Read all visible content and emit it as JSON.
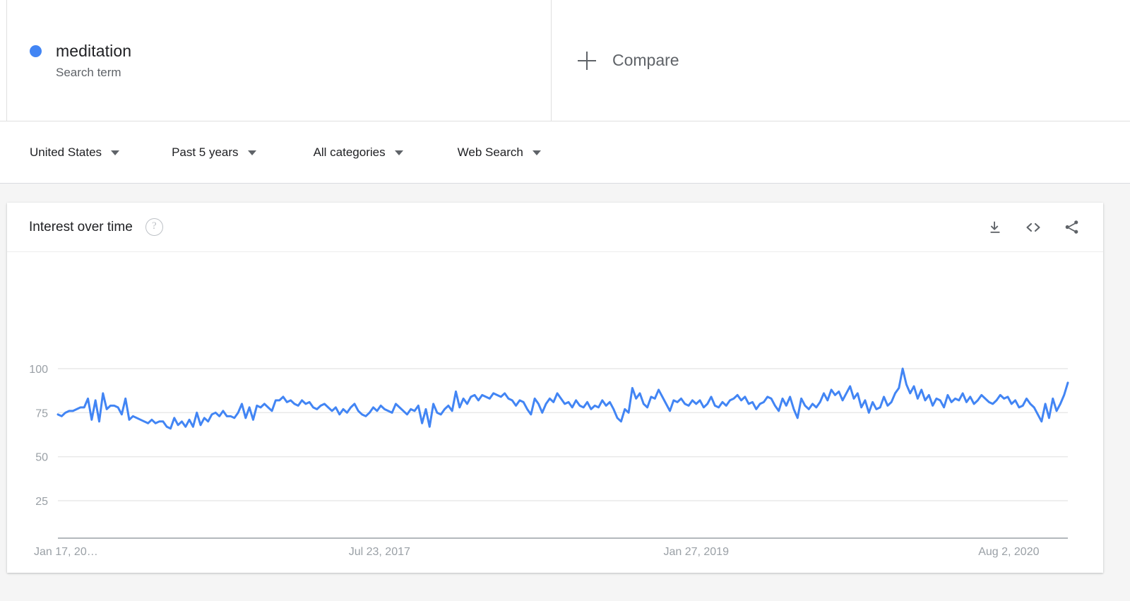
{
  "term": {
    "name": "meditation",
    "subtitle": "Search term",
    "dot_color": "#4285f4"
  },
  "compare": {
    "label": "Compare",
    "icon": "plus-icon"
  },
  "filters": [
    {
      "label": "United States",
      "icon": "chevron-down-icon"
    },
    {
      "label": "Past 5 years",
      "icon": "chevron-down-icon"
    },
    {
      "label": "All categories",
      "icon": "chevron-down-icon"
    },
    {
      "label": "Web Search",
      "icon": "chevron-down-icon"
    }
  ],
  "card": {
    "title": "Interest over time",
    "help_icon": "?",
    "actions": [
      {
        "name": "download-icon",
        "title": "Download CSV"
      },
      {
        "name": "embed-code-icon",
        "title": "Embed"
      },
      {
        "name": "share-icon",
        "title": "Share"
      }
    ]
  },
  "chart_data": {
    "type": "line",
    "title": "Interest over time",
    "xlabel": "",
    "ylabel": "",
    "ylim": [
      0,
      107
    ],
    "yticks": [
      25,
      50,
      75,
      100
    ],
    "grid": true,
    "legend": false,
    "line_color": "#4285f4",
    "line_width": 3,
    "xtick_labels": [
      "Jan 17, 20…",
      "Jul 23, 2017",
      "Jan 27, 2019",
      "Aug 2, 2020"
    ],
    "xtick_positions": [
      0,
      0.3117,
      0.6234,
      0.9351
    ],
    "series": [
      {
        "name": "meditation",
        "values": [
          74,
          73,
          75,
          76,
          76,
          77,
          78,
          78,
          83,
          71,
          82,
          70,
          86,
          77,
          79,
          79,
          78,
          74,
          83,
          71,
          73,
          72,
          71,
          70,
          69,
          71,
          69,
          70,
          70,
          67,
          66,
          72,
          68,
          70,
          67,
          71,
          67,
          75,
          68,
          72,
          70,
          74,
          75,
          73,
          76,
          73,
          73,
          72,
          75,
          80,
          72,
          78,
          71,
          79,
          78,
          80,
          78,
          76,
          82,
          82,
          84,
          81,
          82,
          80,
          79,
          82,
          80,
          81,
          78,
          77,
          79,
          80,
          78,
          76,
          78,
          74,
          77,
          75,
          78,
          80,
          76,
          74,
          73,
          75,
          78,
          76,
          79,
          77,
          76,
          75,
          80,
          78,
          76,
          74,
          77,
          76,
          79,
          69,
          77,
          67,
          80,
          75,
          74,
          77,
          79,
          76,
          87,
          78,
          83,
          80,
          84,
          85,
          82,
          85,
          84,
          83,
          86,
          85,
          84,
          86,
          83,
          82,
          79,
          82,
          81,
          77,
          74,
          83,
          80,
          75,
          80,
          83,
          81,
          86,
          83,
          80,
          81,
          78,
          82,
          79,
          78,
          81,
          77,
          79,
          78,
          82,
          79,
          81,
          77,
          72,
          70,
          77,
          75,
          89,
          83,
          86,
          80,
          78,
          84,
          83,
          88,
          84,
          80,
          76,
          82,
          81,
          83,
          80,
          79,
          82,
          80,
          82,
          78,
          80,
          84,
          79,
          78,
          81,
          79,
          82,
          83,
          85,
          82,
          84,
          80,
          81,
          77,
          80,
          81,
          84,
          83,
          79,
          76,
          83,
          79,
          84,
          77,
          72,
          83,
          79,
          77,
          80,
          78,
          81,
          86,
          82,
          88,
          85,
          87,
          82,
          86,
          90,
          83,
          86,
          78,
          82,
          75,
          81,
          77,
          78,
          84,
          79,
          81,
          86,
          89,
          100,
          91,
          86,
          90,
          83,
          88,
          82,
          85,
          79,
          83,
          82,
          78,
          85,
          81,
          83,
          82,
          86,
          81,
          84,
          80,
          82,
          85,
          83,
          81,
          80,
          82,
          85,
          83,
          84,
          80,
          82,
          78,
          79,
          83,
          80,
          78,
          74,
          70,
          80,
          72,
          83,
          76,
          80,
          85,
          92
        ]
      }
    ]
  }
}
